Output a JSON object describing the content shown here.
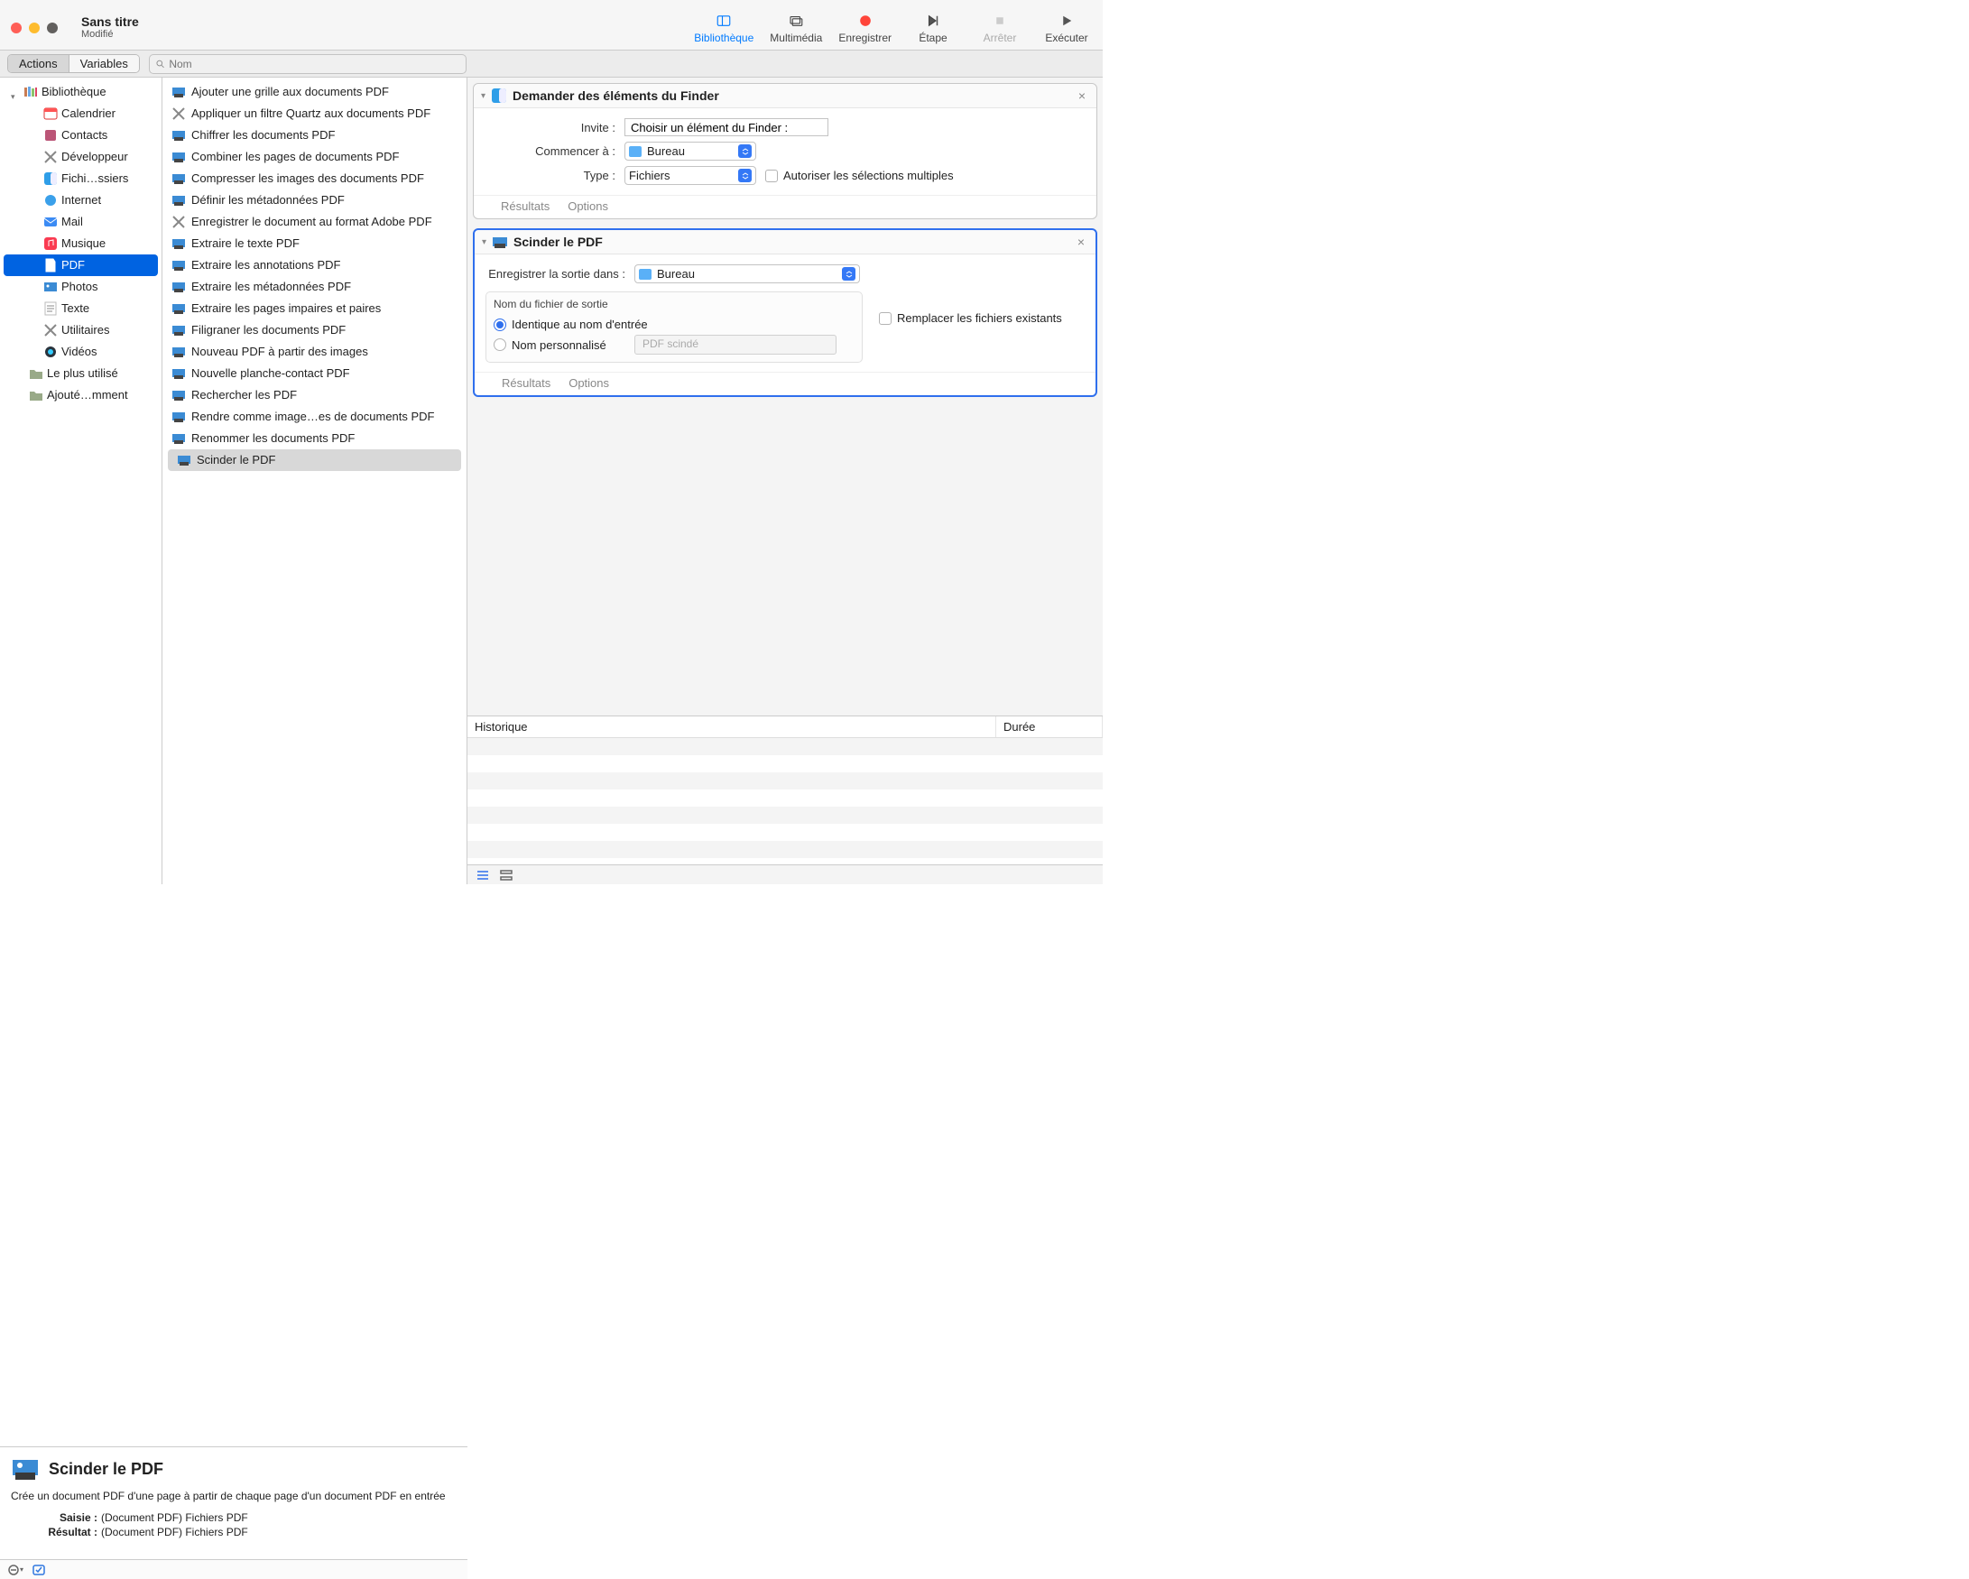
{
  "window": {
    "title": "Sans titre",
    "subtitle": "Modifié"
  },
  "toolbar": {
    "library": "Bibliothèque",
    "media": "Multimédia",
    "record": "Enregistrer",
    "step": "Étape",
    "stop": "Arrêter",
    "run": "Exécuter"
  },
  "secbar": {
    "actions": "Actions",
    "variables": "Variables",
    "search_placeholder": "Nom"
  },
  "sidebar": {
    "root": "Bibliothèque",
    "items": [
      {
        "label": "Calendrier"
      },
      {
        "label": "Contacts"
      },
      {
        "label": "Développeur"
      },
      {
        "label": "Fichi…ssiers"
      },
      {
        "label": "Internet"
      },
      {
        "label": "Mail"
      },
      {
        "label": "Musique"
      },
      {
        "label": "PDF",
        "selected": true
      },
      {
        "label": "Photos"
      },
      {
        "label": "Texte"
      },
      {
        "label": "Utilitaires"
      },
      {
        "label": "Vidéos"
      }
    ],
    "most_used": "Le plus utilisé",
    "recently_added": "Ajouté…mment"
  },
  "actions": [
    {
      "label": "Ajouter une grille aux documents PDF"
    },
    {
      "label": "Appliquer un filtre Quartz aux documents PDF"
    },
    {
      "label": "Chiffrer les documents PDF"
    },
    {
      "label": "Combiner les pages de documents PDF"
    },
    {
      "label": "Compresser les images des documents PDF"
    },
    {
      "label": "Définir les métadonnées PDF"
    },
    {
      "label": "Enregistrer le document au format Adobe PDF"
    },
    {
      "label": "Extraire le texte PDF"
    },
    {
      "label": "Extraire les annotations PDF"
    },
    {
      "label": "Extraire les métadonnées PDF"
    },
    {
      "label": "Extraire les pages impaires et paires"
    },
    {
      "label": "Filigraner les documents PDF"
    },
    {
      "label": "Nouveau PDF à partir des images"
    },
    {
      "label": "Nouvelle planche-contact PDF"
    },
    {
      "label": "Rechercher les PDF"
    },
    {
      "label": "Rendre comme image…es de documents PDF"
    },
    {
      "label": "Renommer les documents PDF"
    },
    {
      "label": "Scinder le PDF",
      "selected": true
    }
  ],
  "description": {
    "title": "Scinder le PDF",
    "body": "Crée un document PDF d'une page à partir de chaque page d'un document PDF en entrée",
    "input_label": "Saisie :",
    "input_value": "(Document PDF) Fichiers PDF",
    "result_label": "Résultat :",
    "result_value": "(Document PDF) Fichiers PDF"
  },
  "workflow": {
    "card1": {
      "title": "Demander des éléments du Finder",
      "prompt_label": "Invite :",
      "prompt_value": "Choisir un élément du Finder :",
      "start_label": "Commencer à :",
      "start_value": "Bureau",
      "type_label": "Type :",
      "type_value": "Fichiers",
      "allow_multi": "Autoriser les sélections multiples",
      "results": "Résultats",
      "options": "Options"
    },
    "card2": {
      "title": "Scinder le PDF",
      "output_label": "Enregistrer la sortie dans :",
      "output_value": "Bureau",
      "group_title": "Nom du fichier de sortie",
      "same_name": "Identique au nom d'entrée",
      "custom_name": "Nom personnalisé",
      "custom_placeholder": "PDF scindé",
      "replace": "Remplacer les fichiers existants",
      "results": "Résultats",
      "options": "Options"
    }
  },
  "history": {
    "col1": "Historique",
    "col2": "Durée"
  }
}
